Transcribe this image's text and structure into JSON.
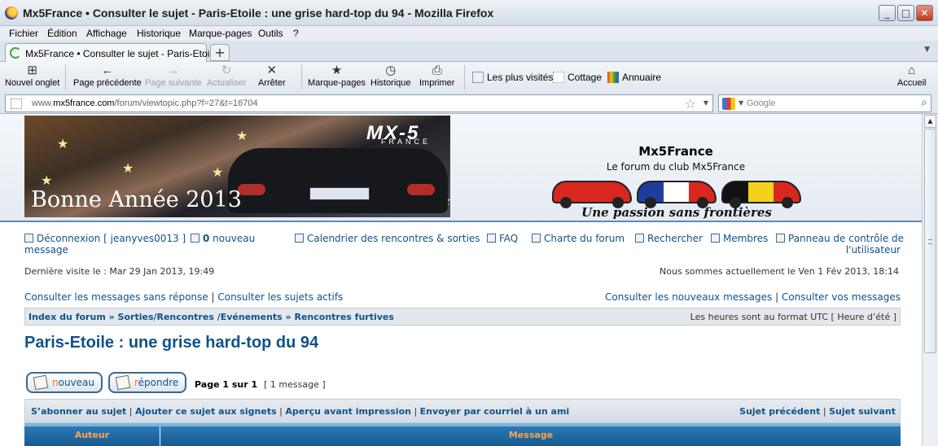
{
  "window": {
    "title": "Mx5France • Consulter le sujet - Paris-Etoile : une grise hard-top du 94 - Mozilla Firefox"
  },
  "menu": [
    "Fichier",
    "Édition",
    "Affichage",
    "Historique",
    "Marque-pages",
    "Outils",
    "?"
  ],
  "tab": {
    "label": "Mx5France • Consulter le sujet - Paris-Etoile ...",
    "new_tab": "+"
  },
  "toolbar": {
    "new_tab": "Nouvel onglet",
    "back": "Page précédente",
    "forward": "Page suivante",
    "reload": "Actualiser",
    "stop": "Arrêter",
    "bookmarks": "Marque-pages",
    "history": "Historique",
    "print": "Imprimer",
    "most_visited": "Les plus visités",
    "cottage": "Cottage",
    "annuaire": "Annuaire",
    "home": "Accueil"
  },
  "url": {
    "prefix": "www.",
    "domain": "mx5france.com",
    "path": "/forum/viewtopic.php?f=27&t=16704"
  },
  "search": {
    "placeholder": "Google"
  },
  "banner": {
    "logo": "MX-5",
    "logo_sub": "FRANCE",
    "greeting": "Bonne Année 2013"
  },
  "site": {
    "title": "Mx5France",
    "description": "Le forum du club Mx5France",
    "slogan": "Une passion sans frontières"
  },
  "nav": {
    "logout": "Déconnexion [ jeanyves0013 ]",
    "new_msgs_count": "0",
    "new_msgs_label": " nouveau",
    "new_msgs_label2": "message",
    "calendar": "Calendrier des rencontres & sorties",
    "faq": "FAQ",
    "charter": "Charte du forum",
    "search": "Rechercher",
    "members": "Membres",
    "ucp": "Panneau de contrôle de",
    "ucp2": "l'utilisateur"
  },
  "visit": {
    "last": "Dernière visite le : Mar 29 Jan 2013, 19:49",
    "now": "Nous sommes actuellement le Ven 1 Fév 2013, 18:14"
  },
  "links": {
    "unanswered": "Consulter les messages sans réponse",
    "active": "Consulter les sujets actifs",
    "new_posts": "Consulter les nouveaux messages",
    "your_posts": "Consulter vos messages",
    "sep": " | "
  },
  "breadcrumb": {
    "items": [
      "Index du forum",
      "Sorties/Rencontres /Evénements",
      "Rencontres furtives"
    ],
    "sep": " » ",
    "timezone": "Les heures sont au format UTC [ Heure d’été ]"
  },
  "topic": {
    "title": "Paris-Etoile : une grise hard-top du 94"
  },
  "buttons": {
    "new_first": "n",
    "new_rest": "ouveau",
    "reply_first": "r",
    "reply_rest": "épondre"
  },
  "pagination": {
    "page": "Page 1 sur 1",
    "count": "[ 1 message ]"
  },
  "actions": {
    "subscribe": "S’abonner au sujet",
    "bookmark": "Ajouter ce sujet aux signets",
    "print": "Aperçu avant impression",
    "email": "Envoyer par courriel à un ami",
    "prev": "Sujet précédent",
    "next": "Sujet suivant",
    "sep": " | "
  },
  "table": {
    "author": "Auteur",
    "message": "Message"
  },
  "colors": {
    "link": "#105289",
    "header_orange": "#ffa34f",
    "table_blue": "#155a8f"
  }
}
